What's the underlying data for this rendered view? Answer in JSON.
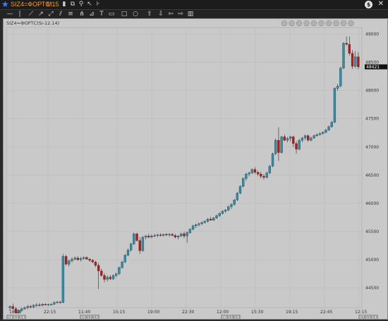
{
  "window": {
    "symbol": "SIZ4=ФОРТС",
    "timeframe": "M15",
    "icons": [
      "star-icon",
      "bar-chart-icon",
      "new-window-icon",
      "link-icon",
      "cursor-icon",
      "indicator-icon",
      "dollar-icon",
      "close-icon"
    ]
  },
  "toolbar": {
    "tools": [
      "horizontal-line-icon",
      "vertical-line-icon",
      "trend-line-icon",
      "ray-icon",
      "extended-line-icon",
      "channel-icon",
      "fib-icon",
      "pitchfork-icon",
      "gann-icon",
      "text-icon",
      "label-icon",
      "rectangle-icon",
      "ellipse-icon",
      "arrow-up-icon",
      "arrow-down-icon",
      "arrow-left-icon",
      "arrow-right-icon",
      "trash-icon"
    ]
  },
  "chart": {
    "instrument_label": "SIZ4=ФОРТС(Si-12.14)",
    "current_price": "48421",
    "colors": {
      "up": "#2f8fa8",
      "down": "#c01515",
      "background": "#c9c9c9",
      "grid": "#b9b9b9",
      "price_tag": "#111111"
    },
    "nav_icons": [
      "first-icon",
      "prev-icon",
      "play-icon",
      "next-icon",
      "last-icon",
      "zoom-in-icon",
      "zoom-out-icon",
      "grid-icon",
      "settings-icon",
      "lock-icon"
    ]
  },
  "chart_data": {
    "type": "candlestick",
    "y_ticks": [
      "49000",
      "48500",
      "48000",
      "47500",
      "47000",
      "46500",
      "46000",
      "45500",
      "45000",
      "44500"
    ],
    "ylim": [
      44150,
      49120
    ],
    "x_ticks": [
      "18:20",
      "22:15",
      "11:40",
      "15:15",
      "19:00",
      "22:30",
      "12:00",
      "15:30",
      "19:15",
      "22:45",
      "12:15"
    ],
    "x_dates": [
      "04.11.14",
      "05.11.14",
      "06.11.14",
      "07.11.14"
    ],
    "candles": [
      [
        44150,
        44190,
        44100,
        44170
      ],
      [
        44170,
        44220,
        44120,
        44130
      ],
      [
        44130,
        44160,
        44040,
        44060
      ],
      [
        44060,
        44120,
        44040,
        44100
      ],
      [
        44100,
        44150,
        44080,
        44130
      ],
      [
        44130,
        44170,
        44110,
        44150
      ],
      [
        44150,
        44200,
        44120,
        44170
      ],
      [
        44170,
        44200,
        44140,
        44160
      ],
      [
        44160,
        44210,
        44140,
        44190
      ],
      [
        44190,
        44230,
        44160,
        44200
      ],
      [
        44200,
        44230,
        44170,
        44190
      ],
      [
        44190,
        44230,
        44170,
        44210
      ],
      [
        44210,
        44230,
        44190,
        44200
      ],
      [
        44200,
        44220,
        44180,
        44210
      ],
      [
        44210,
        44230,
        44190,
        44210
      ],
      [
        44210,
        44260,
        44200,
        44240
      ],
      [
        44240,
        44270,
        44220,
        44250
      ],
      [
        44250,
        44270,
        44220,
        44240
      ],
      [
        44240,
        45100,
        44230,
        45060
      ],
      [
        45060,
        45090,
        44900,
        44920
      ],
      [
        44920,
        45000,
        44880,
        44980
      ],
      [
        44980,
        45040,
        44950,
        45010
      ],
      [
        45010,
        45060,
        44990,
        45030
      ],
      [
        45030,
        45060,
        44980,
        45000
      ],
      [
        45000,
        45050,
        44970,
        45020
      ],
      [
        45020,
        45060,
        45000,
        45040
      ],
      [
        45040,
        45060,
        45000,
        45010
      ],
      [
        45010,
        45030,
        44960,
        44990
      ],
      [
        44990,
        45010,
        44940,
        44960
      ],
      [
        44960,
        44980,
        44870,
        44900
      ],
      [
        44900,
        44940,
        44480,
        44800
      ],
      [
        44800,
        44840,
        44700,
        44720
      ],
      [
        44720,
        44760,
        44600,
        44650
      ],
      [
        44650,
        44720,
        44610,
        44690
      ],
      [
        44690,
        44730,
        44640,
        44660
      ],
      [
        44660,
        44740,
        44640,
        44720
      ],
      [
        44720,
        44770,
        44690,
        44750
      ],
      [
        44750,
        44880,
        44730,
        44860
      ],
      [
        44860,
        44980,
        44840,
        44960
      ],
      [
        44960,
        45100,
        44940,
        45080
      ],
      [
        45080,
        45200,
        45060,
        45170
      ],
      [
        45170,
        45300,
        45140,
        45280
      ],
      [
        45280,
        45480,
        45260,
        45460
      ],
      [
        45460,
        45480,
        45320,
        45340
      ],
      [
        45340,
        45400,
        45100,
        45160
      ],
      [
        45160,
        45420,
        45140,
        45400
      ],
      [
        45400,
        45440,
        45360,
        45420
      ],
      [
        45420,
        45460,
        45380,
        45400
      ],
      [
        45400,
        45450,
        45380,
        45420
      ],
      [
        45420,
        45460,
        45400,
        45430
      ],
      [
        45430,
        45460,
        45400,
        45440
      ],
      [
        45440,
        45470,
        45410,
        45430
      ],
      [
        45430,
        45460,
        45410,
        45450
      ],
      [
        45450,
        45470,
        45420,
        45440
      ],
      [
        45440,
        45470,
        45410,
        45450
      ],
      [
        45450,
        45470,
        45420,
        45430
      ],
      [
        45430,
        45460,
        45380,
        45400
      ],
      [
        45400,
        45440,
        45360,
        45420
      ],
      [
        45420,
        45480,
        45400,
        45460
      ],
      [
        45460,
        45500,
        45380,
        45420
      ],
      [
        45420,
        45500,
        45300,
        45480
      ],
      [
        45480,
        45560,
        45460,
        45540
      ],
      [
        45540,
        45620,
        45520,
        45600
      ],
      [
        45600,
        45640,
        45560,
        45620
      ],
      [
        45620,
        45660,
        45590,
        45640
      ],
      [
        45640,
        45680,
        45610,
        45660
      ],
      [
        45660,
        45700,
        45640,
        45680
      ],
      [
        45680,
        45740,
        45660,
        45720
      ],
      [
        45720,
        45760,
        45690,
        45700
      ],
      [
        45700,
        45760,
        45690,
        45740
      ],
      [
        45740,
        45800,
        45720,
        45780
      ],
      [
        45780,
        45840,
        45760,
        45820
      ],
      [
        45820,
        45880,
        45800,
        45860
      ],
      [
        45860,
        45900,
        45830,
        45880
      ],
      [
        45880,
        45960,
        45860,
        45940
      ],
      [
        45940,
        46000,
        45900,
        45980
      ],
      [
        45980,
        46080,
        45960,
        46060
      ],
      [
        46060,
        46200,
        46040,
        46180
      ],
      [
        46180,
        46320,
        46160,
        46300
      ],
      [
        46300,
        46460,
        46280,
        46440
      ],
      [
        46440,
        46540,
        46400,
        46520
      ],
      [
        46520,
        46560,
        46480,
        46540
      ],
      [
        46540,
        46620,
        46520,
        46600
      ],
      [
        46600,
        46640,
        46520,
        46550
      ],
      [
        46550,
        46580,
        46480,
        46520
      ],
      [
        46520,
        46560,
        46440,
        46480
      ],
      [
        46480,
        46520,
        46420,
        46460
      ],
      [
        46460,
        46560,
        46440,
        46540
      ],
      [
        46540,
        46680,
        46520,
        46660
      ],
      [
        46660,
        46900,
        46640,
        46880
      ],
      [
        46880,
        47150,
        46860,
        47120
      ],
      [
        47120,
        47350,
        46750,
        46900
      ],
      [
        46900,
        47200,
        46880,
        47180
      ],
      [
        47180,
        47220,
        47100,
        47120
      ],
      [
        47120,
        47180,
        47080,
        47150
      ],
      [
        47150,
        47200,
        47100,
        47180
      ],
      [
        47180,
        47200,
        47000,
        47060
      ],
      [
        47060,
        47100,
        46880,
        46960
      ],
      [
        46960,
        47140,
        46940,
        47120
      ],
      [
        47120,
        47180,
        47080,
        47160
      ],
      [
        47160,
        47220,
        47120,
        47200
      ],
      [
        47200,
        47220,
        47090,
        47120
      ],
      [
        47120,
        47180,
        47100,
        47160
      ],
      [
        47160,
        47220,
        47140,
        47200
      ],
      [
        47200,
        47240,
        47180,
        47220
      ],
      [
        47220,
        47260,
        47200,
        47240
      ],
      [
        47240,
        47280,
        47220,
        47260
      ],
      [
        47260,
        47320,
        47240,
        47300
      ],
      [
        47300,
        47380,
        47280,
        47360
      ],
      [
        47360,
        47460,
        47340,
        47440
      ],
      [
        47440,
        48060,
        47420,
        48040
      ],
      [
        48040,
        48120,
        48000,
        48080
      ],
      [
        48080,
        48420,
        48060,
        48400
      ],
      [
        48400,
        48860,
        48380,
        48840
      ],
      [
        48840,
        48960,
        48800,
        48820
      ],
      [
        48820,
        48960,
        48620,
        48660
      ],
      [
        48660,
        48720,
        48380,
        48430
      ],
      [
        48430,
        48700,
        48400,
        48600
      ],
      [
        48600,
        48680,
        48380,
        48421
      ]
    ]
  }
}
